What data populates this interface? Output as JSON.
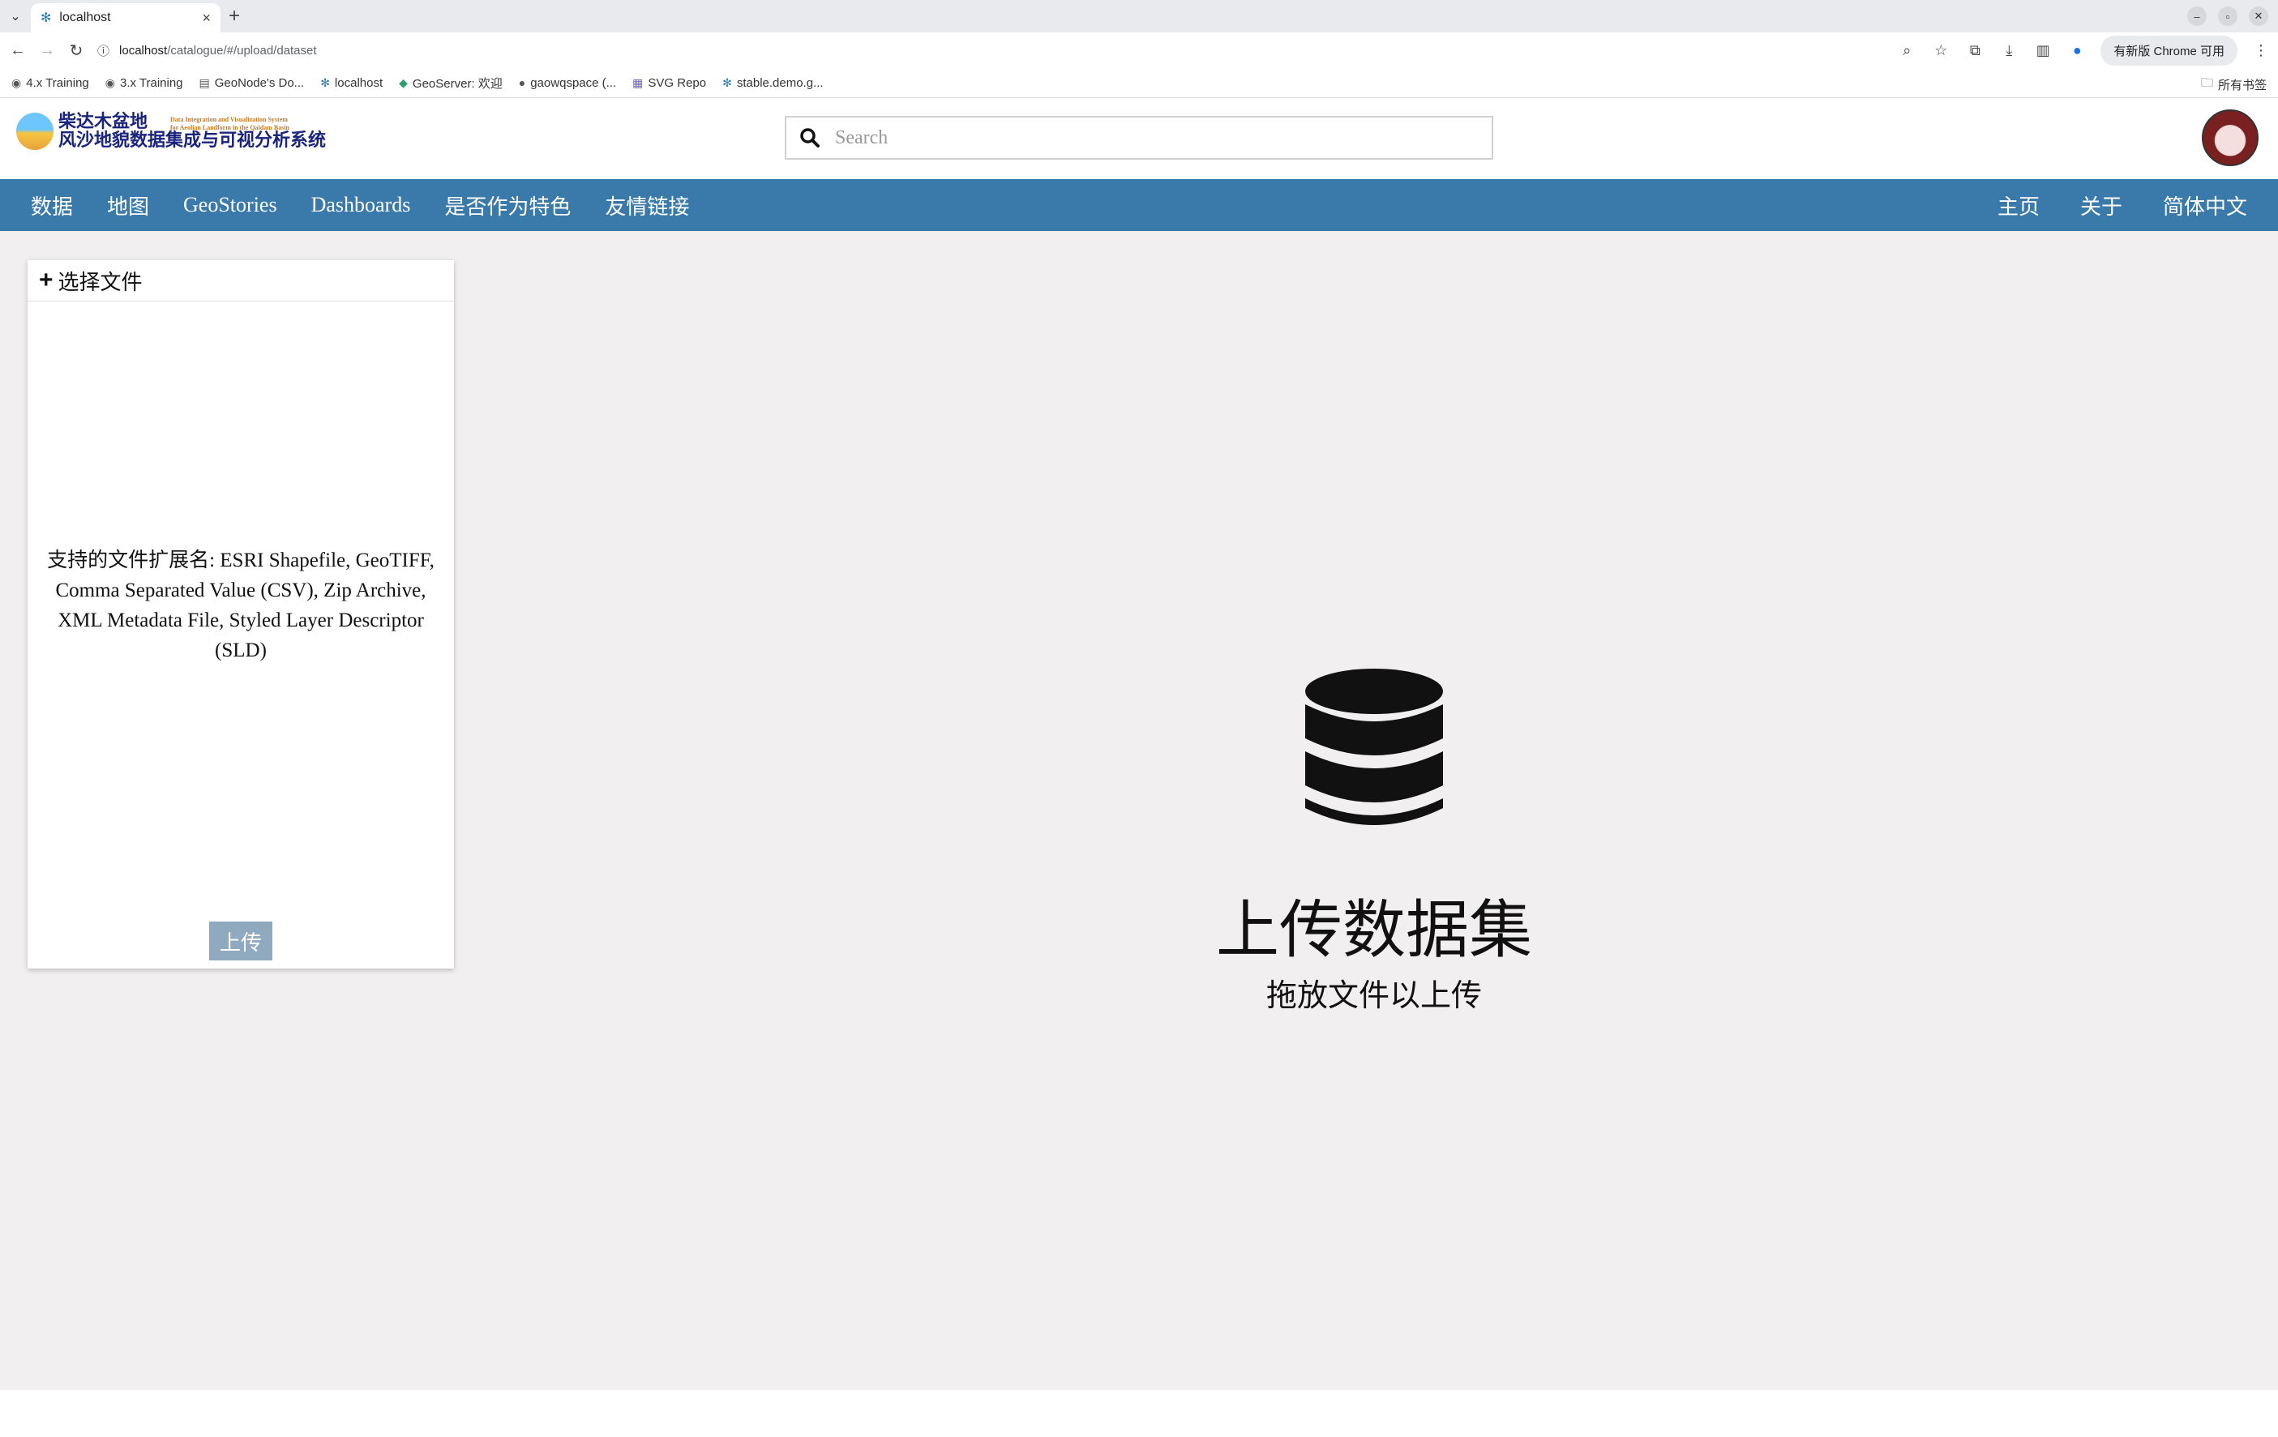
{
  "browser": {
    "tab_title": "localhost",
    "url_host": "localhost",
    "url_path": "/catalogue/#/upload/dataset",
    "update_label": "有新版 Chrome 可用",
    "bookmarks": [
      "4.x Training",
      "3.x Training",
      "GeoNode's Do...",
      "localhost",
      "GeoServer: 欢迎",
      "gaowqspace (...",
      "SVG Repo",
      "stable.demo.g..."
    ],
    "all_bookmarks_label": "所有书签"
  },
  "header": {
    "logo_cn_line1": "柴达木盆地",
    "logo_cn_line2": "风沙地貌数据集成与可视分析系统",
    "logo_en_line1": "Data Integration and Visualization System",
    "logo_en_line2": "for Aeolian Landform in the Qaidam Basin",
    "search_placeholder": "Search"
  },
  "nav": {
    "left": [
      "数据",
      "地图",
      "GeoStories",
      "Dashboards",
      "是否作为特色",
      "友情链接"
    ],
    "right": [
      "主页",
      "关于",
      "简体中文"
    ]
  },
  "upload": {
    "choose_file_label": "选择文件",
    "supported_text": "支持的文件扩展名: ESRI Shapefile, GeoTIFF, Comma Separated Value (CSV), Zip Archive, XML Metadata File, Styled Layer Descriptor (SLD)",
    "upload_button": "上传"
  },
  "dropzone": {
    "title": "上传数据集",
    "subtitle": "拖放文件以上传"
  },
  "colors": {
    "navbar": "#397aab",
    "main_bg": "#f1eff0",
    "upload_button_bg": "#8fa9bf"
  }
}
